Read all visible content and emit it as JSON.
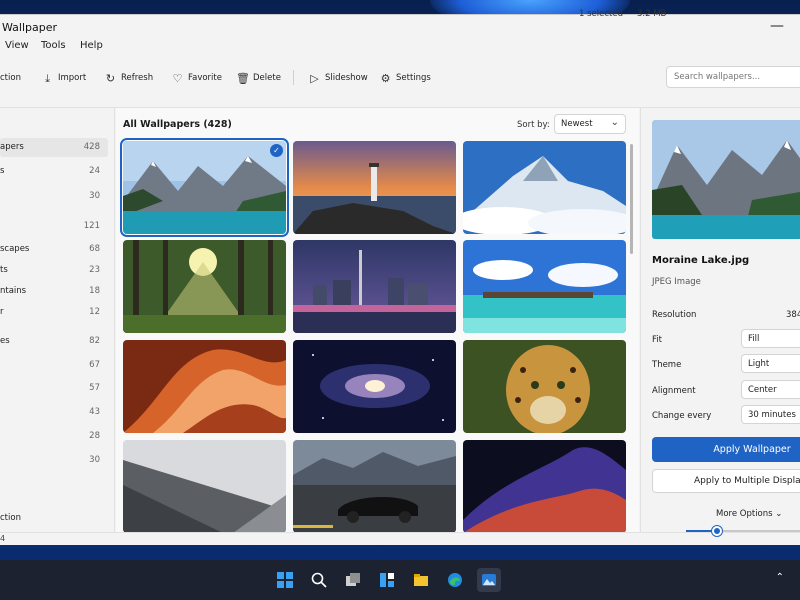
{
  "app": {
    "title": "Wallpaper"
  },
  "menu": {
    "items": [
      "View",
      "Tools",
      "Help"
    ]
  },
  "toolbar": {
    "collection": "ction",
    "import": "Import",
    "refresh": "Refresh",
    "favorite": "Favorite",
    "delete": "Delete",
    "slideshow": "Slideshow",
    "settings": "Settings"
  },
  "search": {
    "placeholder": "Search wallpapers..."
  },
  "sidebar": {
    "items": [
      {
        "label": "apers",
        "count": "428"
      },
      {
        "label": "s",
        "count": "24"
      },
      {
        "label": "",
        "count": "30"
      },
      {
        "label": "",
        "count": "121"
      },
      {
        "label": "scapes",
        "count": "68"
      },
      {
        "label": "ts",
        "count": "23"
      },
      {
        "label": "ntains",
        "count": "18"
      },
      {
        "label": "r",
        "count": "12"
      },
      {
        "label": "es",
        "count": "82"
      },
      {
        "label": "",
        "count": "67"
      },
      {
        "label": "",
        "count": "57"
      },
      {
        "label": "",
        "count": "43"
      },
      {
        "label": "",
        "count": "28"
      },
      {
        "label": "",
        "count": "30"
      }
    ],
    "bottom": "ction"
  },
  "gallery": {
    "title": "All Wallpapers (428)",
    "sort_label": "Sort by:",
    "sort_value": "Newest",
    "thumbnails": [
      "lake-mountains",
      "lighthouse-sunset",
      "snowy-peak",
      "forest-sunbeams",
      "city-skyline-night",
      "tropical-overwater-bungalows",
      "slot-canyon",
      "spiral-galaxy",
      "leopard",
      "architecture-abstract",
      "sports-car-road",
      "abstract-waves"
    ]
  },
  "details": {
    "file_name": "Moraine Lake.jpg",
    "file_type": "JPEG Image",
    "resolution_label": "Resolution",
    "resolution_value": "384",
    "fit_label": "Fit",
    "fit_value": "Fill",
    "theme_label": "Theme",
    "theme_value": "Light",
    "alignment_label": "Alignment",
    "alignment_value": "Center",
    "change_label": "Change every",
    "change_value": "30 minutes",
    "apply": "Apply Wallpaper",
    "apply_multi": "Apply to Multiple Display",
    "more_options": "More Options"
  },
  "status": {
    "left": "4",
    "selected": "1 selected",
    "size": "3.2 MB",
    "zoom_fraction": 0.27
  },
  "colors": {
    "accent": "#1f64c5"
  }
}
